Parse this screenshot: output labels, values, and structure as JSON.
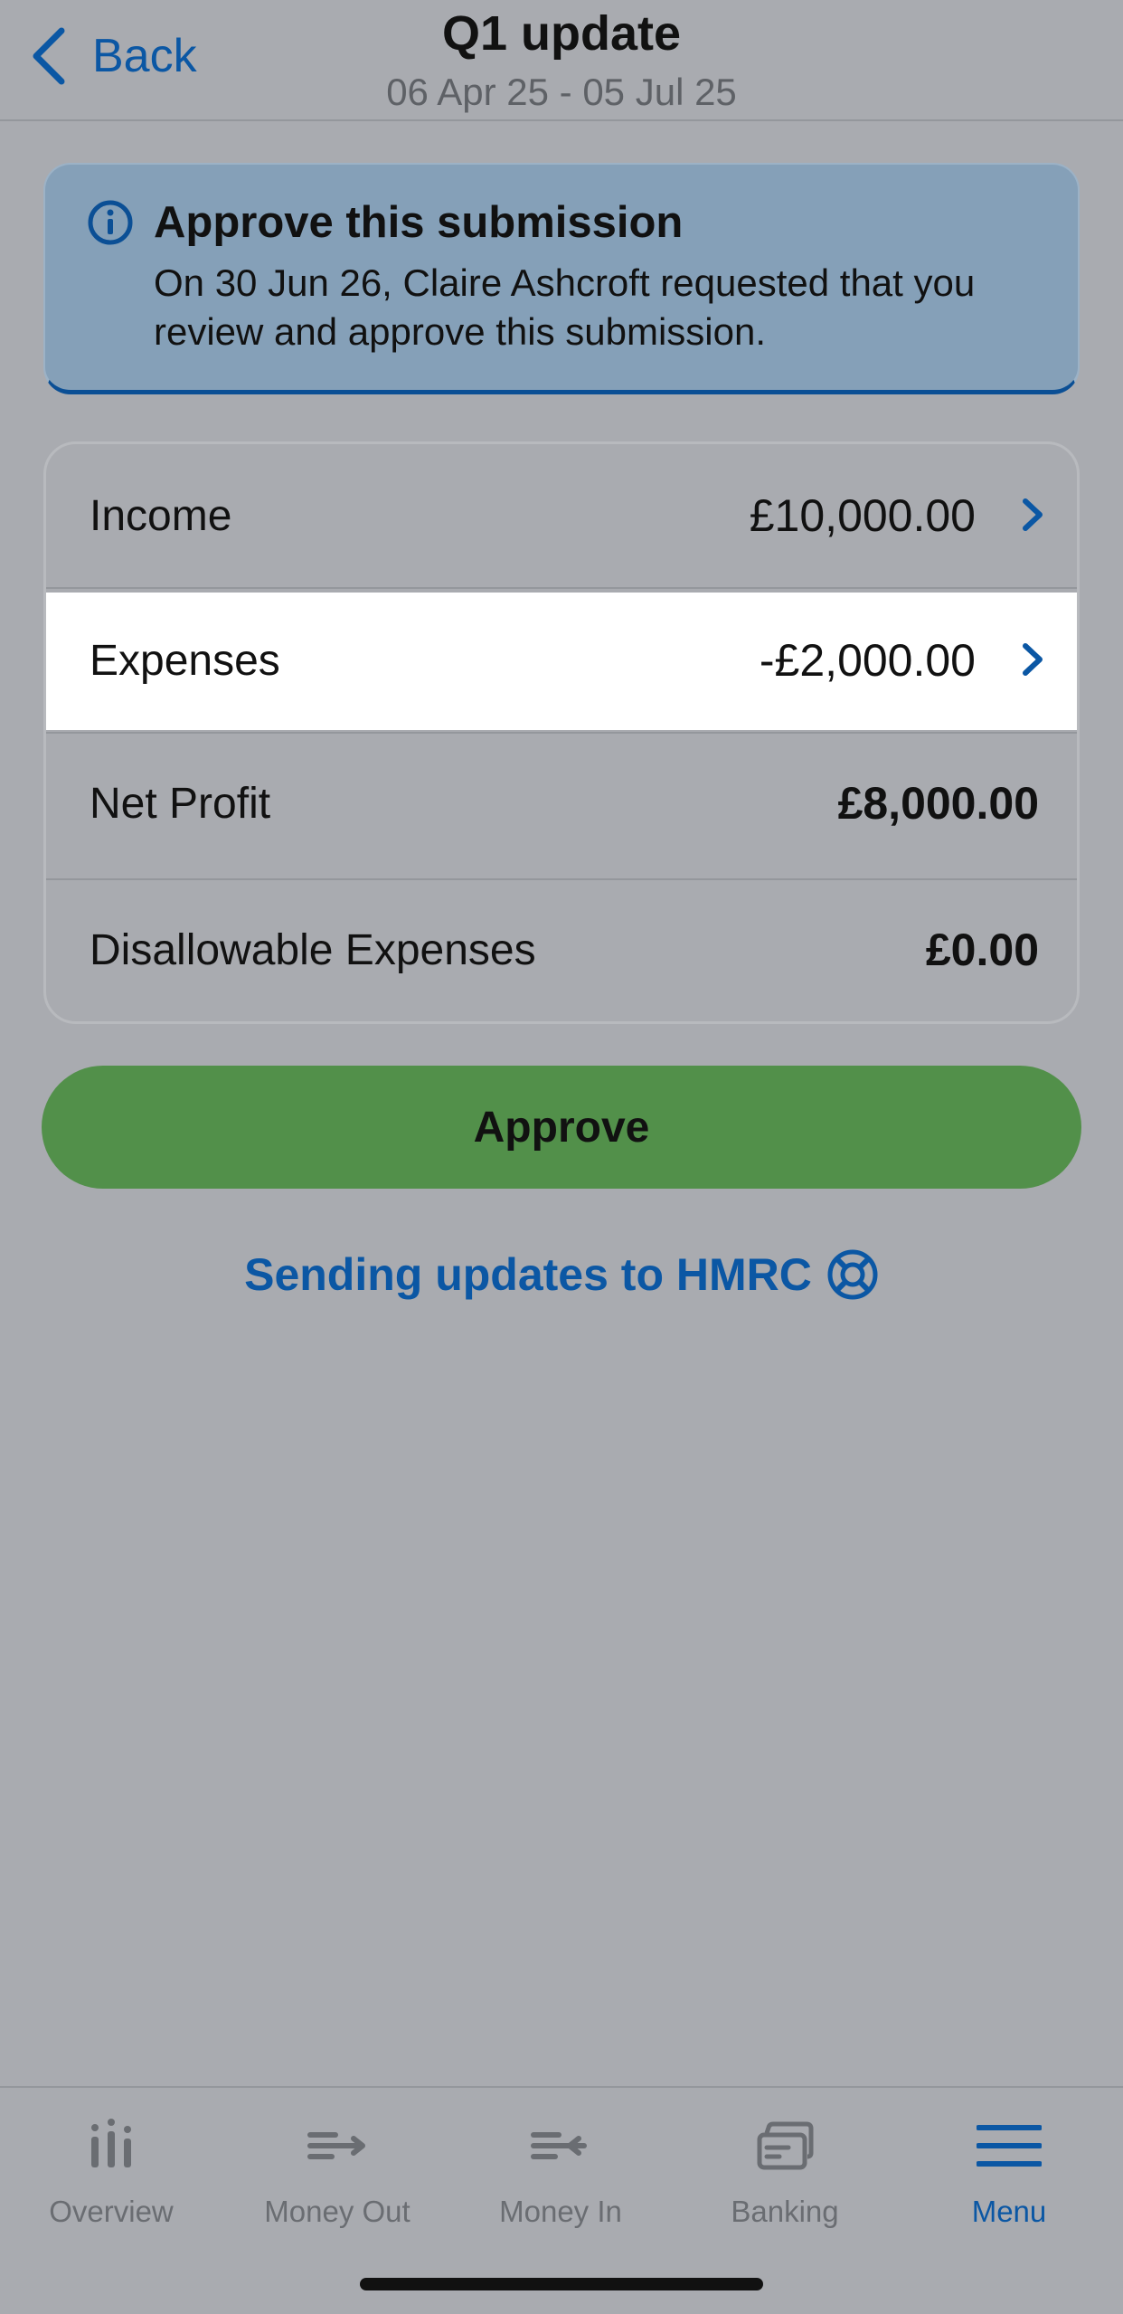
{
  "header": {
    "back_label": "Back",
    "title": "Q1 update",
    "subtitle": "06 Apr 25 - 05 Jul 25"
  },
  "banner": {
    "title": "Approve this submission",
    "text": "On 30 Jun 26, Claire Ashcroft requested that you review and approve this submission."
  },
  "summary": [
    {
      "label": "Income",
      "value": "£10,000.00"
    },
    {
      "label": "Expenses",
      "value": "-£2,000.00"
    },
    {
      "label": "Net Profit",
      "value": "£8,000.00"
    },
    {
      "label": "Disallowable Expenses",
      "value": "£0.00"
    }
  ],
  "approve_label": "Approve",
  "help_link": "Sending updates to HMRC",
  "tabs": [
    {
      "label": "Overview",
      "icon": "bar-chart-icon"
    },
    {
      "label": "Money Out",
      "icon": "money-out-icon"
    },
    {
      "label": "Money In",
      "icon": "money-in-icon"
    },
    {
      "label": "Banking",
      "icon": "bank-cards-icon"
    },
    {
      "label": "Menu",
      "icon": "hamburger-menu-icon",
      "active": true
    }
  ],
  "colors": {
    "accent": "#0b57a4",
    "approve": "#52904a",
    "banner": "#85a0b8",
    "background": "#a9abb0"
  }
}
